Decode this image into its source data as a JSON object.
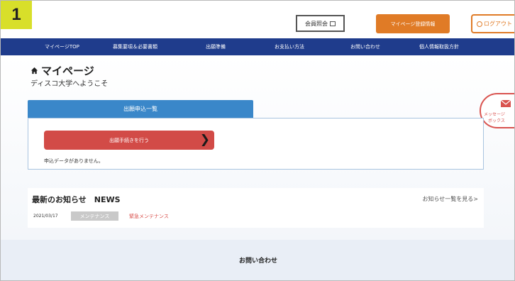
{
  "step_badge": "1",
  "header": {
    "member_info_label": "会員照会",
    "mypage_register_label": "マイページ登録情報",
    "logout_label": "ログアウト"
  },
  "nav": {
    "items": [
      {
        "label": "マイページTOP"
      },
      {
        "label": "募集要項＆必要書類"
      },
      {
        "label": "出願準備"
      },
      {
        "label": "お支払い方法"
      },
      {
        "label": "お問い合わせ"
      },
      {
        "label": "個人情報取扱方針"
      }
    ]
  },
  "main": {
    "title": "マイページ",
    "welcome": "ディスコ大学へようこそ"
  },
  "message_box": {
    "line1": "メッセージ",
    "line2": "ボックス"
  },
  "applications": {
    "tab_label": "出願申込一覧",
    "apply_button_label": "出願手続きを行う",
    "no_data_text": "申込データがありません。"
  },
  "news": {
    "title": "最新のお知らせ　NEWS",
    "more_link": "お知らせ一覧を見る>",
    "items": [
      {
        "date": "2021/03/17",
        "category": "メンテナンス",
        "title": "緊急メンテナンス"
      }
    ]
  },
  "footer": {
    "contact_heading": "お問い合わせ"
  },
  "colors": {
    "nav_bg": "#1f3c8c",
    "accent_orange": "#e07b26",
    "tab_blue": "#3a87c9",
    "apply_red": "#d24b47",
    "badge_yellow": "#d8df2a"
  }
}
